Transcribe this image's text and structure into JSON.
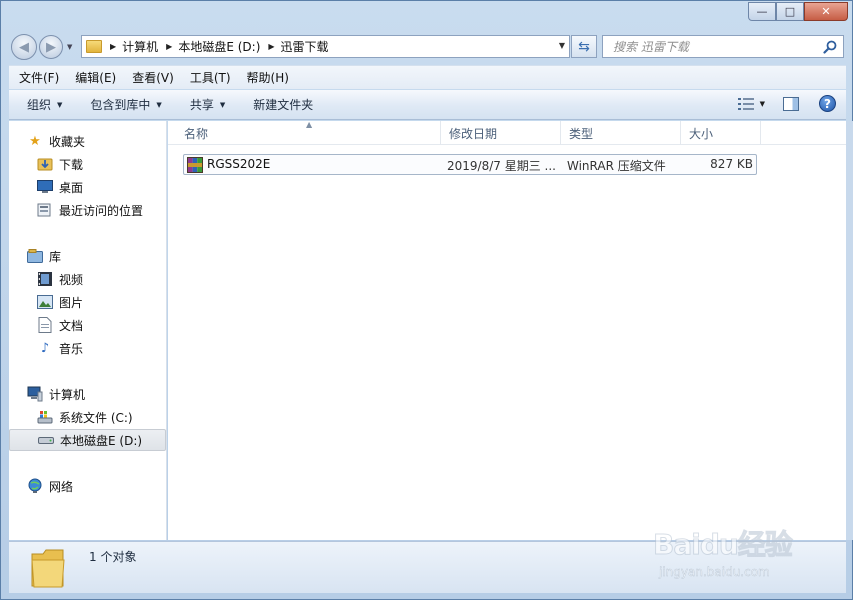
{
  "window": {
    "ghost_tabs": [
      "",
      "",
      "",
      "",
      "",
      ""
    ],
    "controls": {
      "minimize": "—",
      "maximize": "□",
      "close": "✕"
    }
  },
  "address": {
    "crumbs": [
      "计算机",
      "本地磁盘E (D:)",
      "迅雷下载"
    ],
    "search_placeholder": "搜索 迅雷下载"
  },
  "menubar": [
    "文件(F)",
    "编辑(E)",
    "查看(V)",
    "工具(T)",
    "帮助(H)"
  ],
  "toolbar": {
    "organize": "组织",
    "include_in_library": "包含到库中",
    "share": "共享",
    "new_folder": "新建文件夹"
  },
  "nav": {
    "favorites": "收藏夹",
    "downloads": "下载",
    "desktop": "桌面",
    "recent": "最近访问的位置",
    "libraries": "库",
    "videos": "视频",
    "pictures": "图片",
    "documents": "文档",
    "music": "音乐",
    "computer": "计算机",
    "drive_c": "系统文件 (C:)",
    "drive_d": "本地磁盘E (D:)",
    "network": "网络"
  },
  "columns": {
    "name": "名称",
    "modified": "修改日期",
    "type": "类型",
    "size": "大小"
  },
  "files": [
    {
      "name": "RGSS202E",
      "modified": "2019/8/7 星期三 ...",
      "type": "WinRAR 压缩文件",
      "size": "827 KB"
    }
  ],
  "details": {
    "count": "1 个对象"
  },
  "watermark": {
    "logo": "Baidu经验",
    "url": "jingyan.baidu.com"
  },
  "colors": {
    "accent": "#3a6fb0",
    "nav_selected": "#e3e7ec",
    "folder": "#e8bf4f"
  }
}
